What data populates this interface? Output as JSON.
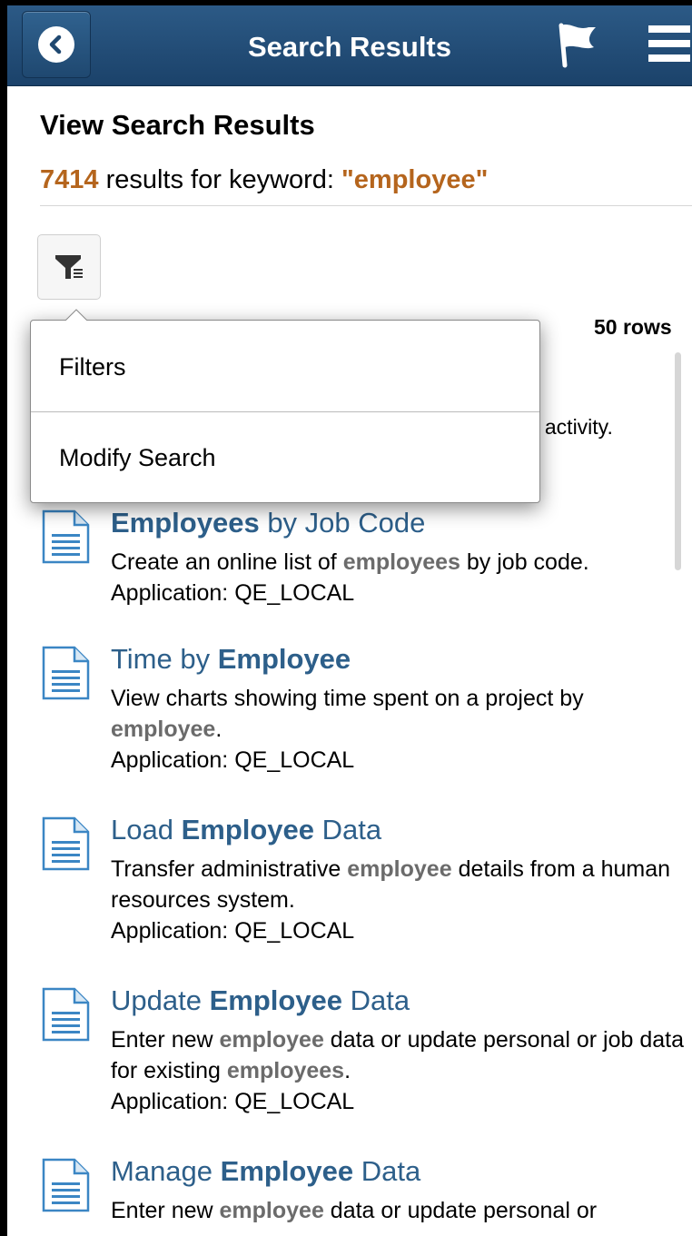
{
  "header": {
    "title": "Search Results",
    "back_icon": "back-chevron-icon",
    "flag_icon": "flag-icon",
    "menu_icon": "hamburger-menu-icon"
  },
  "page": {
    "title": "View Search Results",
    "count": "7414",
    "count_text": " results for keyword: ",
    "keyword": "\"employee\"",
    "rows_label": "50 rows",
    "obscured_text": "y activity."
  },
  "popup": {
    "items": [
      {
        "label": "Filters"
      },
      {
        "label": "Modify Search"
      }
    ]
  },
  "results": [
    {
      "title_pre": "",
      "title_hl": "Employees",
      "title_post": " by Job Code",
      "desc_parts": [
        "Create an online list of ",
        "employees",
        " by job code."
      ],
      "app": "Application: QE_LOCAL"
    },
    {
      "title_pre": "Time by ",
      "title_hl": "Employee",
      "title_post": "",
      "desc_parts": [
        "View charts showing time spent on a project by ",
        "employee",
        "."
      ],
      "app": "Application: QE_LOCAL"
    },
    {
      "title_pre": "Load ",
      "title_hl": "Employee",
      "title_post": " Data",
      "desc_parts": [
        "Transfer administrative ",
        "employee",
        " details from a human resources system."
      ],
      "app": "Application: QE_LOCAL"
    },
    {
      "title_pre": "Update ",
      "title_hl": "Employee",
      "title_post": " Data",
      "desc_parts": [
        "Enter new ",
        "employee",
        " data or update personal or job data for existing ",
        "employees",
        "."
      ],
      "app": "Application: QE_LOCAL"
    },
    {
      "title_pre": "Manage ",
      "title_hl": "Employee",
      "title_post": " Data",
      "desc_parts": [
        "Enter new ",
        "employee",
        " data or update personal or"
      ],
      "app": ""
    }
  ],
  "colors": {
    "header": "#1f4870",
    "keyword_accent": "#b5651d",
    "link": "#2d5f8a",
    "highlight": "#6b6b6b"
  }
}
